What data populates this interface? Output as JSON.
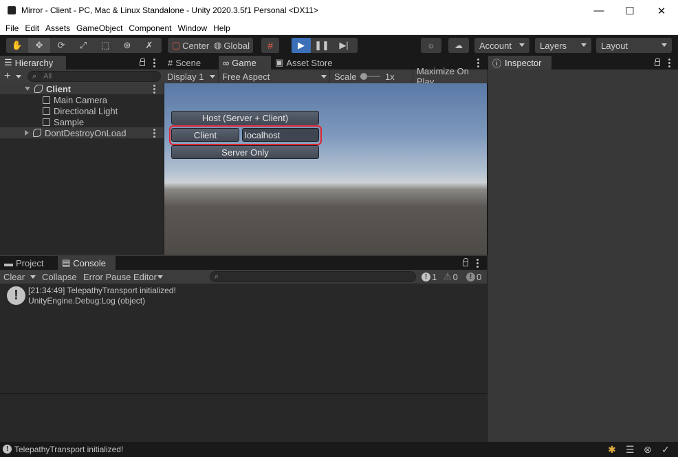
{
  "window": {
    "title": "Mirror - Client - PC, Mac & Linux Standalone - Unity 2020.3.5f1 Personal <DX11>",
    "minimize": "—",
    "maximize": "☐",
    "close": "✕"
  },
  "menu": [
    "File",
    "Edit",
    "Assets",
    "GameObject",
    "Component",
    "Window",
    "Help"
  ],
  "toolbar": {
    "tools": [
      "hand",
      "move",
      "rotate",
      "scale",
      "rect",
      "transform",
      "custom"
    ],
    "pivot": "Center",
    "space": "Global",
    "account": "Account",
    "layers": "Layers",
    "layout": "Layout"
  },
  "hierarchy": {
    "tab": "Hierarchy",
    "add": "+",
    "search_placeholder": "All",
    "scene": "Client",
    "objects": [
      "Main Camera",
      "Directional Light",
      "Sample"
    ],
    "dont_destroy": "DontDestroyOnLoad"
  },
  "game": {
    "tabs": [
      "Scene",
      "Game",
      "Asset Store"
    ],
    "display": "Display 1",
    "aspect": "Free Aspect",
    "scale_label": "Scale",
    "scale_value": "1x",
    "maximize": "Maximize On Play",
    "host_button": "Host (Server + Client)",
    "client_button": "Client",
    "address": "localhost",
    "server_button": "Server Only",
    "highlight_color": "#e0262e"
  },
  "inspector": {
    "tab": "Inspector"
  },
  "bottom": {
    "tabs": [
      "Project",
      "Console"
    ],
    "clear": "Clear",
    "collapse": "Collapse",
    "error_pause": "Error Pause",
    "editor": "Editor",
    "counts": {
      "log": "1",
      "warn": "0",
      "error": "0"
    },
    "log_line1": "[21:34:49] TelepathyTransport initialized!",
    "log_line2": "UnityEngine.Debug:Log (object)"
  },
  "status": {
    "message": "TelepathyTransport initialized!"
  }
}
